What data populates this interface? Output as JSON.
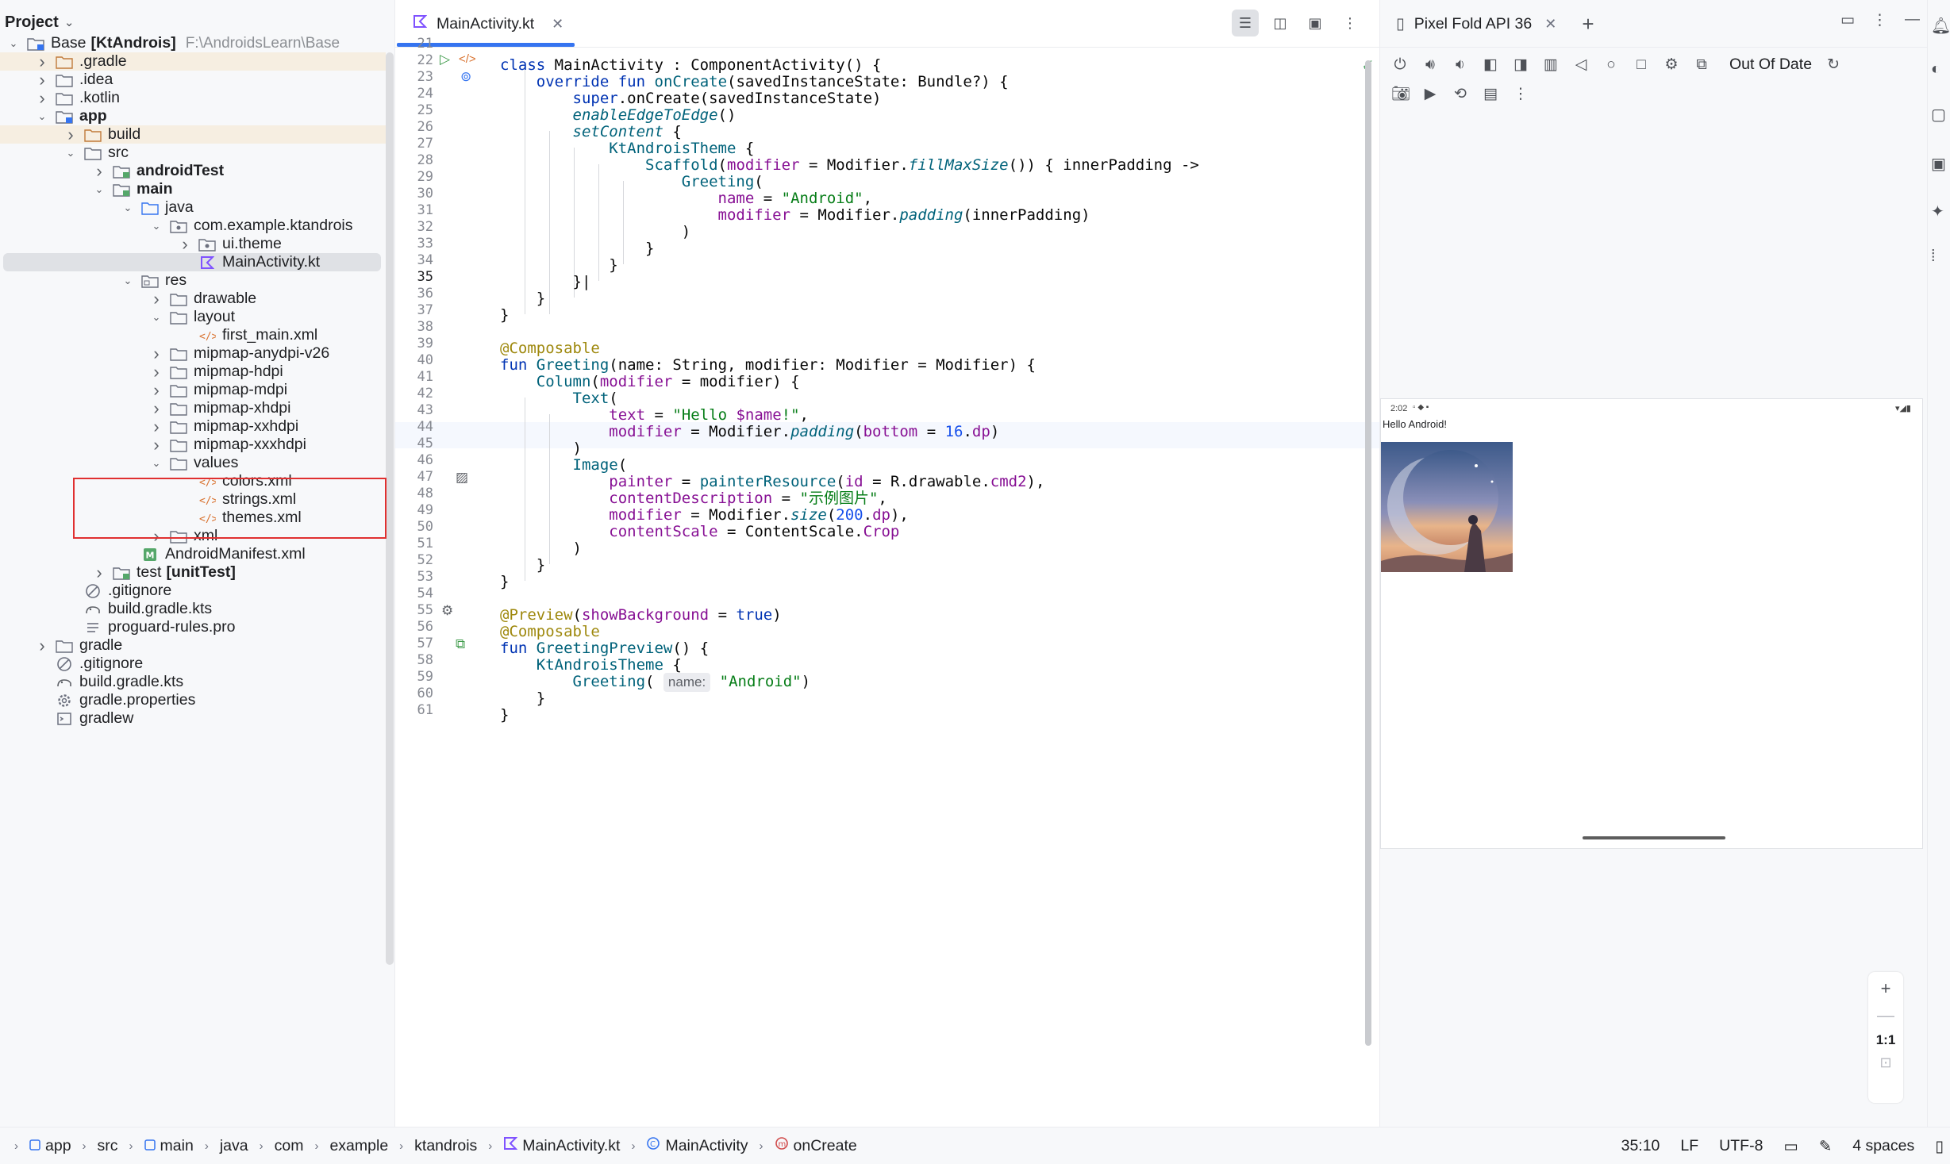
{
  "project_panel": {
    "title": "Project",
    "tree": [
      {
        "label": "Base",
        "suffix": "[KtAndrois]",
        "path": "F:\\AndroidsLearn\\Base",
        "depth": 0,
        "arrow": "down",
        "icon": "module-folder-icon",
        "bold": false
      },
      {
        "label": ".gradle",
        "depth": 1,
        "arrow": "right",
        "icon": "folder-orange-icon",
        "hl": "orange"
      },
      {
        "label": ".idea",
        "depth": 1,
        "arrow": "right",
        "icon": "folder-icon"
      },
      {
        "label": ".kotlin",
        "depth": 1,
        "arrow": "right",
        "icon": "folder-icon"
      },
      {
        "label": "app",
        "depth": 1,
        "arrow": "down",
        "icon": "module-folder-icon",
        "bold": true
      },
      {
        "label": "build",
        "depth": 2,
        "arrow": "right",
        "icon": "folder-orange-icon",
        "hl": "orange"
      },
      {
        "label": "src",
        "depth": 2,
        "arrow": "down",
        "icon": "folder-icon"
      },
      {
        "label": "androidTest",
        "depth": 3,
        "arrow": "right",
        "icon": "test-folder-icon",
        "bold": true
      },
      {
        "label": "main",
        "depth": 3,
        "arrow": "down",
        "icon": "source-folder-icon",
        "bold": true
      },
      {
        "label": "java",
        "depth": 4,
        "arrow": "down",
        "icon": "source-root-icon"
      },
      {
        "label": "com.example.ktandrois",
        "depth": 5,
        "arrow": "down",
        "icon": "package-icon"
      },
      {
        "label": "ui.theme",
        "depth": 6,
        "arrow": "right",
        "icon": "package-icon"
      },
      {
        "label": "MainActivity.kt",
        "depth": 6,
        "arrow": "none",
        "icon": "kotlin-file-icon",
        "selected": true
      },
      {
        "label": "res",
        "depth": 4,
        "arrow": "down",
        "icon": "resource-folder-icon"
      },
      {
        "label": "drawable",
        "depth": 5,
        "arrow": "right",
        "icon": "folder-icon"
      },
      {
        "label": "layout",
        "depth": 5,
        "arrow": "down",
        "icon": "folder-icon"
      },
      {
        "label": "first_main.xml",
        "depth": 6,
        "arrow": "none",
        "icon": "xml-file-icon"
      },
      {
        "label": "mipmap-anydpi-v26",
        "depth": 5,
        "arrow": "right",
        "icon": "folder-icon"
      },
      {
        "label": "mipmap-hdpi",
        "depth": 5,
        "arrow": "right",
        "icon": "folder-icon"
      },
      {
        "label": "mipmap-mdpi",
        "depth": 5,
        "arrow": "right",
        "icon": "folder-icon"
      },
      {
        "label": "mipmap-xhdpi",
        "depth": 5,
        "arrow": "right",
        "icon": "folder-icon"
      },
      {
        "label": "mipmap-xxhdpi",
        "depth": 5,
        "arrow": "right",
        "icon": "folder-icon"
      },
      {
        "label": "mipmap-xxxhdpi",
        "depth": 5,
        "arrow": "right",
        "icon": "folder-icon"
      },
      {
        "label": "values",
        "depth": 5,
        "arrow": "down",
        "icon": "folder-icon"
      },
      {
        "label": "colors.xml",
        "depth": 6,
        "arrow": "none",
        "icon": "xml-file-icon"
      },
      {
        "label": "strings.xml",
        "depth": 6,
        "arrow": "none",
        "icon": "xml-file-icon"
      },
      {
        "label": "themes.xml",
        "depth": 6,
        "arrow": "none",
        "icon": "xml-file-icon"
      },
      {
        "label": "xml",
        "depth": 5,
        "arrow": "right",
        "icon": "folder-icon"
      },
      {
        "label": "AndroidManifest.xml",
        "depth": 4,
        "arrow": "none",
        "icon": "manifest-file-icon"
      },
      {
        "label": "test",
        "suffix": "[unitTest]",
        "depth": 3,
        "arrow": "right",
        "icon": "test-folder-icon"
      },
      {
        "label": ".gitignore",
        "depth": 2,
        "arrow": "none",
        "icon": "ignore-file-icon"
      },
      {
        "label": "build.gradle.kts",
        "depth": 2,
        "arrow": "none",
        "icon": "gradle-file-icon"
      },
      {
        "label": "proguard-rules.pro",
        "depth": 2,
        "arrow": "none",
        "icon": "text-file-icon"
      },
      {
        "label": "gradle",
        "depth": 1,
        "arrow": "right",
        "icon": "folder-icon"
      },
      {
        "label": ".gitignore",
        "depth": 1,
        "arrow": "none",
        "icon": "ignore-file-icon"
      },
      {
        "label": "build.gradle.kts",
        "depth": 1,
        "arrow": "none",
        "icon": "gradle-file-icon"
      },
      {
        "label": "gradle.properties",
        "depth": 1,
        "arrow": "none",
        "icon": "settings-file-icon"
      },
      {
        "label": "gradlew",
        "depth": 1,
        "arrow": "none",
        "icon": "script-file-icon"
      }
    ]
  },
  "editor": {
    "tab_label": "MainActivity.kt",
    "line_numbers": [
      "21",
      "22",
      "23",
      "24",
      "25",
      "26",
      "27",
      "28",
      "29",
      "30",
      "31",
      "32",
      "33",
      "34",
      "35",
      "36",
      "37",
      "38",
      "39",
      "40",
      "41",
      "42",
      "43",
      "44",
      "45",
      "46",
      "47",
      "48",
      "49",
      "50",
      "51",
      "52",
      "53",
      "54",
      "55",
      "56",
      "57",
      "58",
      "59",
      "60",
      "61"
    ],
    "inlay_hint": "name:"
  },
  "preview": {
    "device_tab": "Pixel Fold API 36",
    "status": "Out Of Date",
    "screen_time": "2:02",
    "app_text": "Hello Android!",
    "zoom_ratio": "1:1"
  },
  "status_bar": {
    "breadcrumb": [
      "app",
      "src",
      "main",
      "java",
      "com",
      "example",
      "ktandrois",
      "MainActivity.kt",
      "MainActivity",
      "onCreate"
    ],
    "position": "35:10",
    "line_sep": "LF",
    "encoding": "UTF-8",
    "indent": "4 spaces"
  },
  "colors": {
    "accent": "#3574f0",
    "selection": "#dfe1e5",
    "highlight_box": "#e03030",
    "excluded_folder": "#f6eee1"
  }
}
